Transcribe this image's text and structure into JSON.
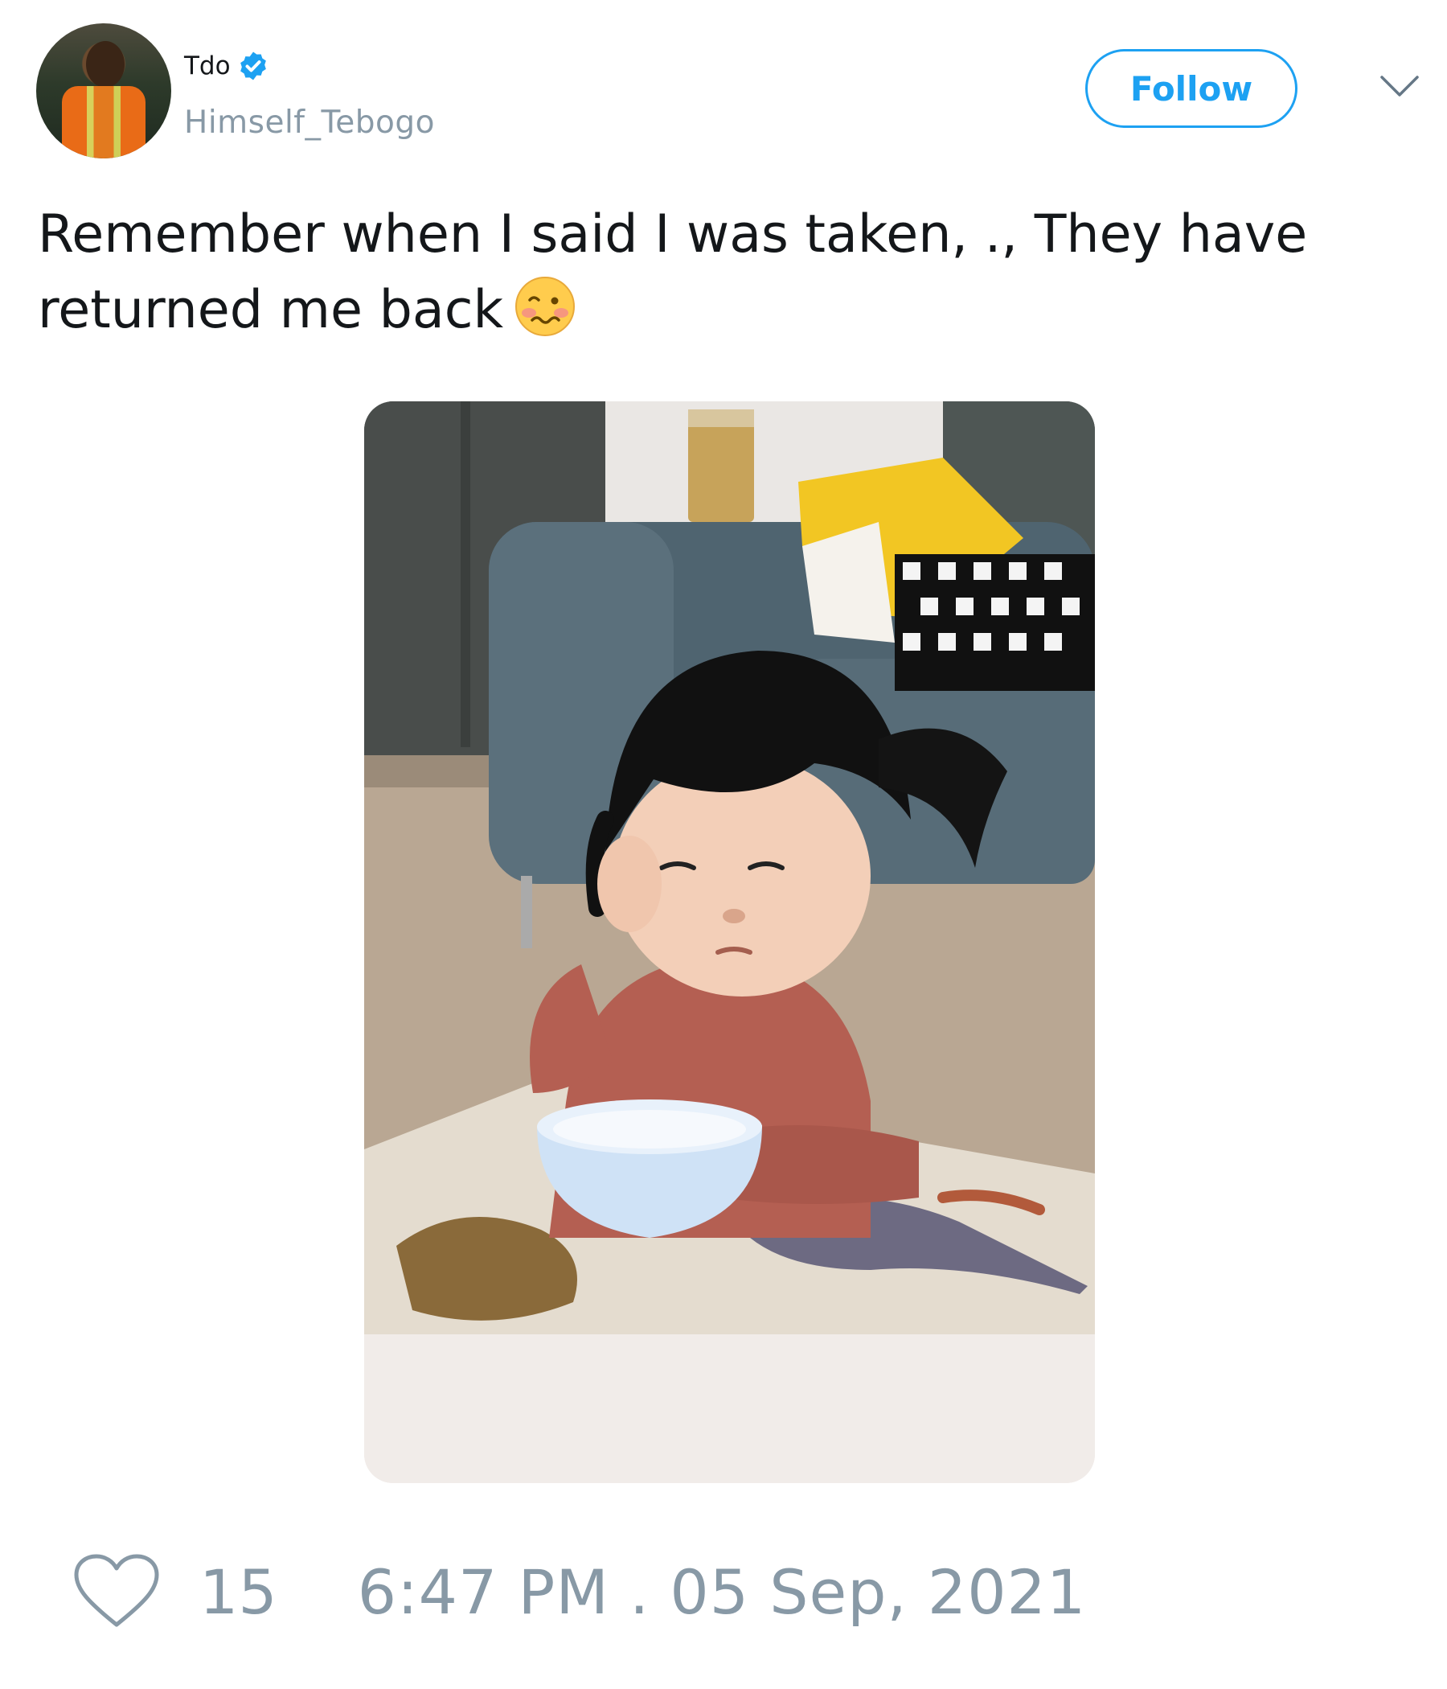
{
  "author": {
    "display_name": "Tdo",
    "handle": "Himself_Tebogo",
    "verified": true
  },
  "header": {
    "follow_label": "Follow",
    "menu_icon": "chevron-down-icon"
  },
  "tweet": {
    "text": "Remember when I said I was taken, ., They have returned me back",
    "emoji": "woozy-face-icon"
  },
  "media": {
    "icon": "photo"
  },
  "footer": {
    "like_icon": "heart-icon",
    "like_count": "15",
    "timestamp": "6:47 PM . 05 Sep, 2021"
  },
  "colors": {
    "accent": "#1da1f2",
    "muted": "#8899a6",
    "text": "#14171a"
  }
}
